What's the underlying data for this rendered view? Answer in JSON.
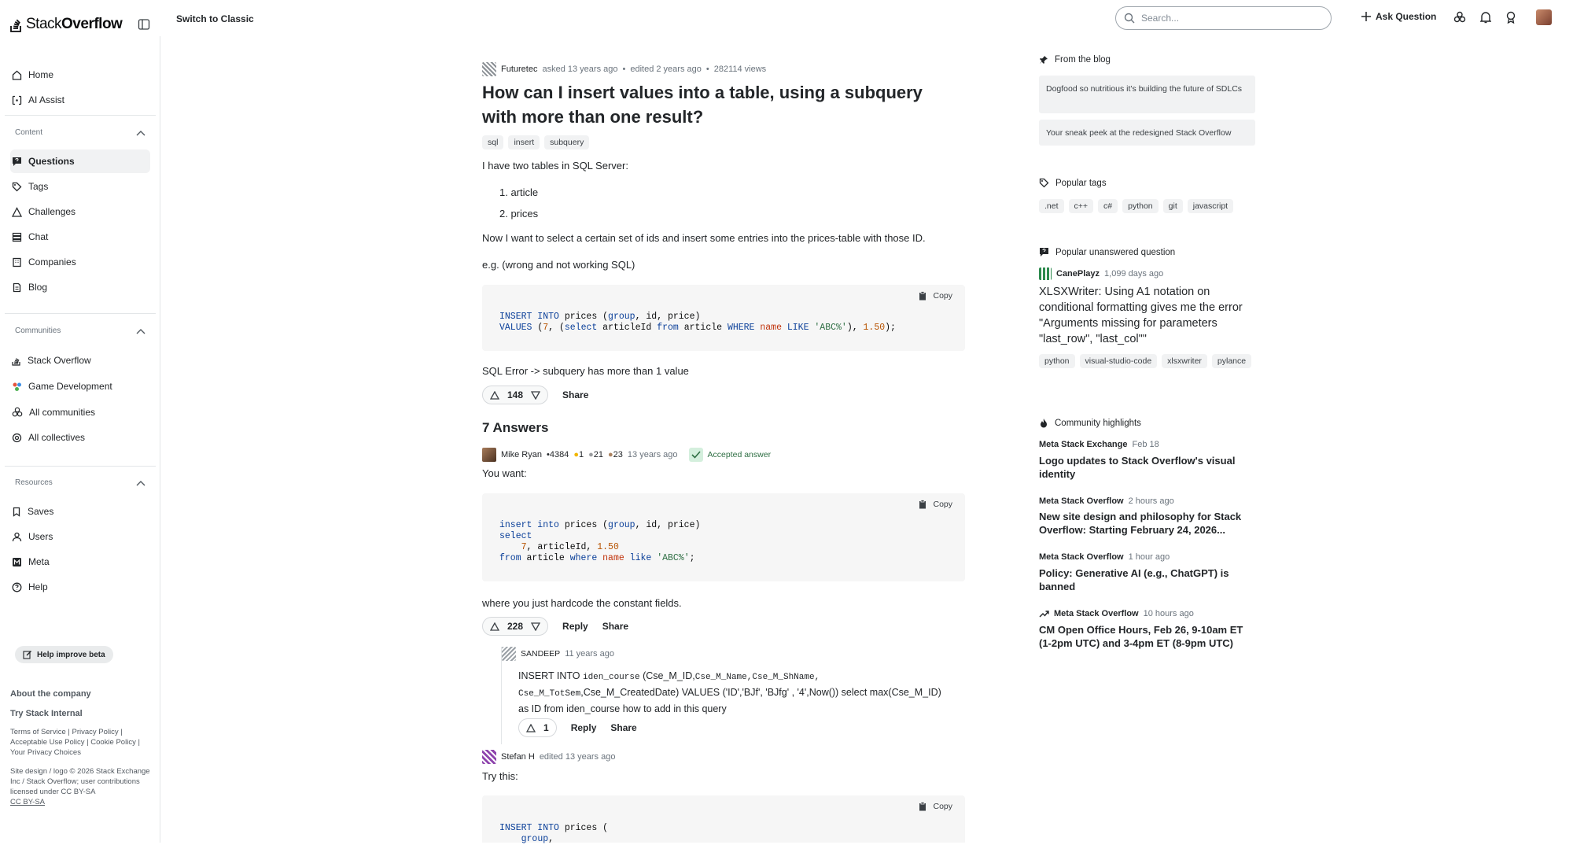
{
  "header": {
    "logo_text_a": "Stack",
    "logo_text_b": "Overflow",
    "switch_label": "Switch to Classic",
    "search_placeholder": "Search...",
    "ask_label": "Ask Question"
  },
  "nav": {
    "home": "Home",
    "ai_assist": "AI Assist",
    "content_section": "Content",
    "questions": "Questions",
    "tags": "Tags",
    "challenges": "Challenges",
    "chat": "Chat",
    "companies": "Companies",
    "blog": "Blog",
    "communities_section": "Communities",
    "stack_overflow": "Stack Overflow",
    "game_development": "Game Development",
    "all_communities": "All communities",
    "all_collectives": "All collectives",
    "resources_section": "Resources",
    "saves": "Saves",
    "users": "Users",
    "meta": "Meta",
    "help": "Help",
    "help_beta": "Help improve beta",
    "about_company": "About the company",
    "try_internal": "Try Stack Internal",
    "footer_links": "Terms of Service  |  Privacy Policy  |  Acceptable Use Policy  |  Cookie Policy  |  Your Privacy Choices",
    "copyright": "Site design / logo © 2026 Stack Exchange Inc / Stack Overflow; user contributions licensed under CC BY-SA",
    "license_link": "CC BY-SA"
  },
  "question": {
    "author": "Futuretec",
    "asked": "asked 13 years ago",
    "edited": "edited 2 years ago",
    "views": "282114 views",
    "title": "How can I insert values into a table, using a subquery with more than one result?",
    "tags": [
      "sql",
      "insert",
      "subquery"
    ],
    "p1": "I have two tables in SQL Server:",
    "list": [
      "1. article",
      "2. prices"
    ],
    "p2": "Now I want to select a certain set of ids and insert some entries into the prices-table with those ID.",
    "p3": "e.g. (wrong and not working SQL)",
    "code_line1": "INSERT INTO prices (group, id, price)",
    "code_line2": "VALUES (7, (select articleId from article WHERE name LIKE 'ABC%'), 1.50);",
    "p4": "SQL Error -> subquery has more than 1 value",
    "votes": "148",
    "share": "Share"
  },
  "answers_heading": "7 Answers",
  "answer1": {
    "author": "Mike Ryan",
    "rep": "4384",
    "gold": "1",
    "silver": "21",
    "bronze": "23",
    "time": "13 years ago",
    "accepted": "Accepted answer",
    "p1": "You want:",
    "code": [
      "insert into prices (group, id, price)",
      "select",
      "    7, articleId, 1.50",
      "from article where name like 'ABC%';"
    ],
    "p2": "where you just hardcode the constant fields.",
    "votes": "228",
    "reply": "Reply",
    "share": "Share"
  },
  "comment": {
    "author": "SANDEEP",
    "time": "11 years ago",
    "text_a": "INSERT INTO ",
    "text_b": "iden_course",
    "text_c": " (Cse_M_ID,",
    "text_d": "Cse_M_Name,Cse_M_ShName,",
    "text_e": "Cse_M_TotSem",
    "text_f": ",Cse_M_CreatedDate) VALUES ('ID','BJf', 'BJfg' , '4',Now()) select max(Cse_M_ID)",
    "text_g": "as ID from iden_course how to add in this query",
    "votes": "1",
    "reply": "Reply",
    "share": "Share"
  },
  "answer2": {
    "author": "Stefan H",
    "edited": "edited 13 years ago",
    "p1": "Try this:",
    "code": [
      "INSERT INTO prices (",
      "    group,"
    ]
  },
  "copy_label": "Copy",
  "right": {
    "blog_heading": "From the blog",
    "blog_items": [
      "Dogfood so nutritious it’s building the future of SDLCs",
      "Your sneak peek at the redesigned Stack Overflow"
    ],
    "popular_tags_heading": "Popular tags",
    "popular_tags": [
      ".net",
      "c++",
      "c#",
      "python",
      "git",
      "javascript"
    ],
    "unanswered_heading": "Popular unanswered question",
    "unanswered_author": "CanePlayz",
    "unanswered_time": "1,099 days ago",
    "unanswered_title": "XLSXWriter: Using A1 notation on conditional formatting gives me the error \"Arguments missing for parameters \"last_row\", \"last_col\"\"",
    "unanswered_tags": [
      "python",
      "visual-studio-code",
      "xlsxwriter",
      "pylance"
    ],
    "highlights_heading": "Community highlights",
    "highlights": [
      {
        "site": "Meta Stack Exchange",
        "time": "Feb 18",
        "title": "Logo updates to Stack Overflow's visual identity"
      },
      {
        "site": "Meta Stack Overflow",
        "time": "2 hours ago",
        "title": "New site design and philosophy for Stack Overflow: Starting February 24, 2026..."
      },
      {
        "site": "Meta Stack Overflow",
        "time": "1 hour ago",
        "title": "Policy: Generative AI (e.g., ChatGPT) is banned"
      },
      {
        "site": "Meta Stack Overflow",
        "time": "10 hours ago",
        "title": "CM Open Office Hours, Feb 26, 9-10am ET (1-2pm UTC) and 3-4pm ET (8-9pm UTC)"
      }
    ]
  },
  "colors": {
    "accent": "#f48225",
    "accepted": "#2f6f44",
    "keyword": "#0a3f99",
    "number": "#b75301",
    "string": "#2f6f44"
  }
}
